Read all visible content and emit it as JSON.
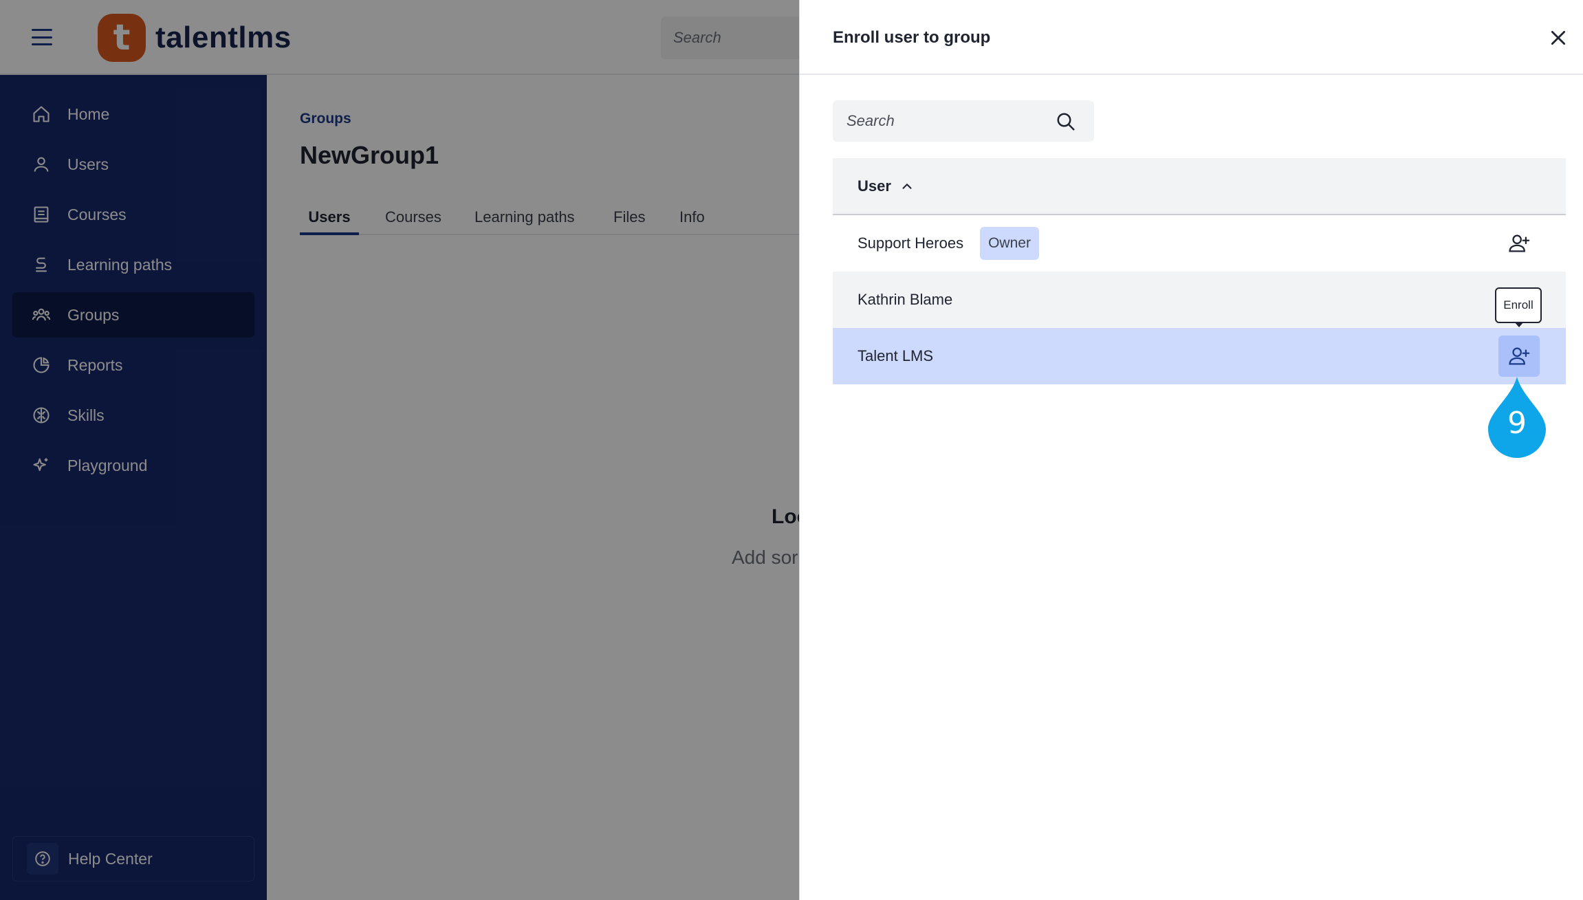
{
  "app": {
    "logo_text": "talentlms",
    "logo_glyph": "t",
    "top_search_placeholder": "Search",
    "colors": {
      "sidebar": "#17286b",
      "sidebar_active": "#0e1a49",
      "brand_orange": "#d9581e",
      "link_blue": "#1d3a8a",
      "row_selected": "#cddafd",
      "step_marker": "#0ea5e9"
    }
  },
  "sidebar": {
    "items": [
      {
        "label": "Home",
        "icon": "home-icon"
      },
      {
        "label": "Users",
        "icon": "user-icon"
      },
      {
        "label": "Courses",
        "icon": "book-icon"
      },
      {
        "label": "Learning paths",
        "icon": "path-icon"
      },
      {
        "label": "Groups",
        "icon": "group-icon",
        "active": true
      },
      {
        "label": "Reports",
        "icon": "pie-chart-icon"
      },
      {
        "label": "Skills",
        "icon": "brain-icon"
      },
      {
        "label": "Playground",
        "icon": "sparkle-icon"
      }
    ],
    "help_label": "Help Center"
  },
  "main": {
    "breadcrumb": "Groups",
    "title": "NewGroup1",
    "tabs": [
      {
        "label": "Users",
        "active": true
      },
      {
        "label": "Courses"
      },
      {
        "label": "Learning paths"
      },
      {
        "label": "Files"
      },
      {
        "label": "Info"
      }
    ],
    "empty_title_partial": "Loo",
    "empty_sub_partial": "Add sor"
  },
  "drawer": {
    "title": "Enroll user to group",
    "search_placeholder": "Search",
    "column_header": "User",
    "rows": [
      {
        "name": "Support Heroes",
        "badge": "Owner"
      },
      {
        "name": "Kathrin Blame"
      },
      {
        "name": "Talent LMS",
        "selected": true
      }
    ],
    "tooltip": "Enroll",
    "step_number": "9"
  }
}
